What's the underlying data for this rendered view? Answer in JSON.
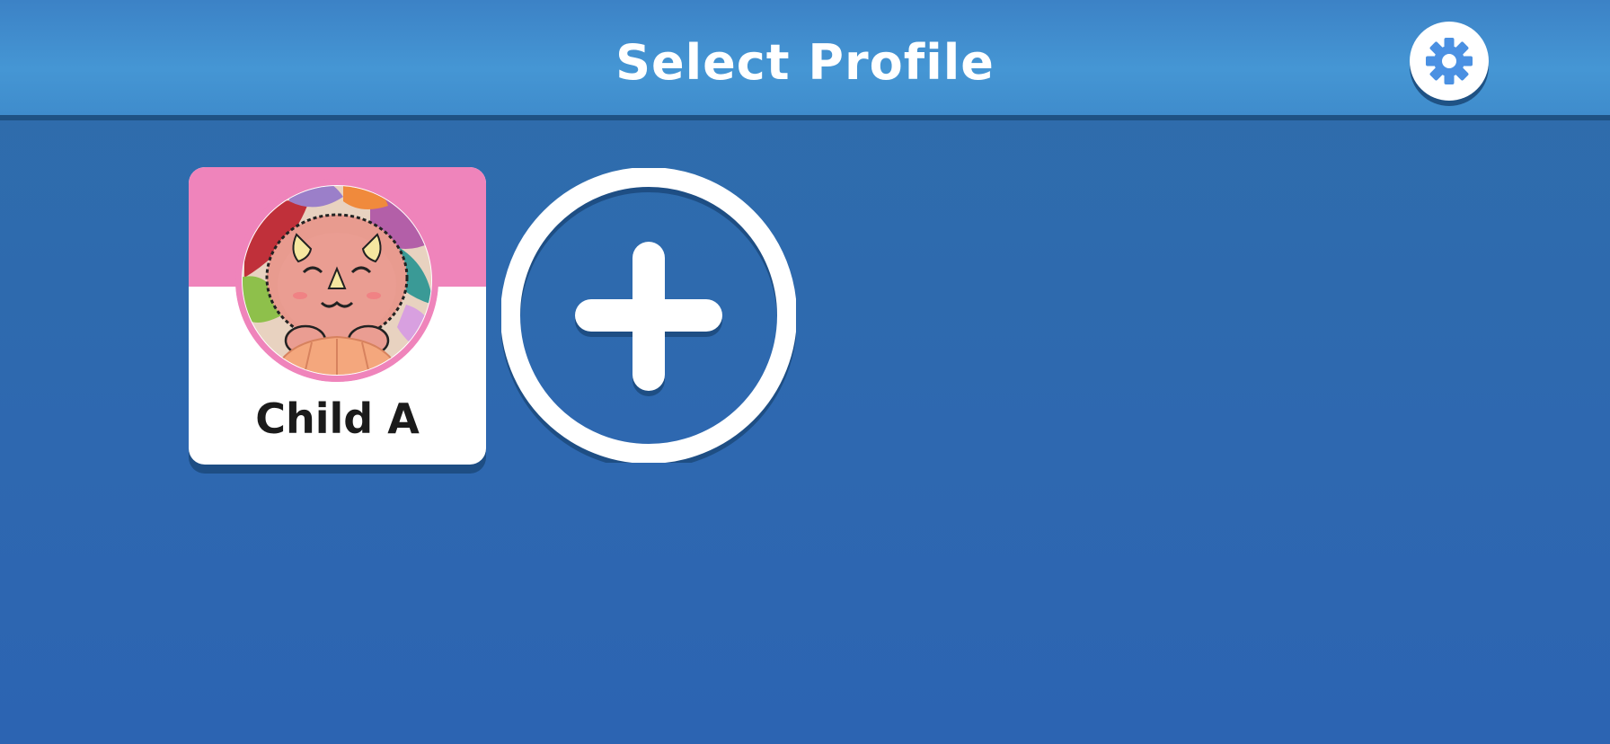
{
  "header": {
    "title": "Select Profile",
    "settings_icon": "gear-icon"
  },
  "profiles": [
    {
      "name": "Child A",
      "avatar_icon": "dinosaur-avatar",
      "accent_color": "#ef84bb"
    }
  ],
  "add_profile": {
    "icon": "plus-icon"
  },
  "colors": {
    "header_background": "#4190d0",
    "page_background": "#2c66b0",
    "profile_accent": "#ef84bb",
    "gear_color": "#4a90e2",
    "text_dark": "#1b1b1b",
    "text_light": "#ffffff"
  }
}
